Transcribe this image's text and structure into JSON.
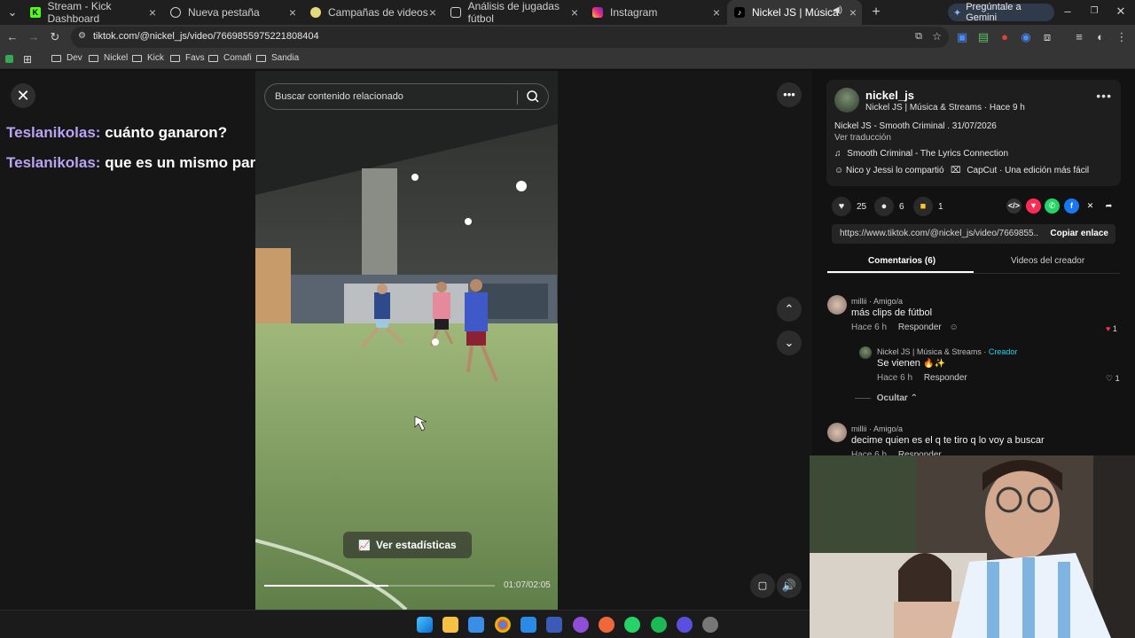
{
  "browser": {
    "tabs": [
      {
        "title": "Stream - Kick Dashboard",
        "icon": "kick-icon",
        "color": "#53fc18",
        "active": false
      },
      {
        "title": "Nueva pestaña",
        "icon": "globe-icon",
        "color": "#cfcfcf",
        "active": false
      },
      {
        "title": "Campañas de videos",
        "icon": "cloud-icon",
        "color": "#e7d97a",
        "active": false
      },
      {
        "title": "Análisis de jugadas fútbol",
        "icon": "chat-icon",
        "color": "#cfcfcf",
        "active": false
      },
      {
        "title": "Instagram",
        "icon": "instagram-icon",
        "color": "#e1306c",
        "active": false
      },
      {
        "title": "Nickel JS | Música & Stream",
        "icon": "tiktok-icon",
        "color": "#ffffff",
        "active": true
      }
    ],
    "gemini_label": "Pregúntale a Gemini",
    "url": "tiktok.com/@nickel_js/video/7669855975221808404",
    "bookmarks": [
      "Dev",
      "Nickel",
      "Kick",
      "Favs",
      "Comafi",
      "Sandia"
    ]
  },
  "chat": {
    "lines": [
      {
        "user": "Teslanikolas:",
        "message": "cuánto ganaron?"
      },
      {
        "user": "Teslanikolas:",
        "message": "que es un mismo partido"
      }
    ]
  },
  "video": {
    "search_placeholder": "Buscar contenido relacionado",
    "stats_label": "Ver estadísticas",
    "time": "01:07/02:05",
    "progress": 0.54
  },
  "post": {
    "username": "nickel_js",
    "subline": "Nickel JS | Música & Streams · Hace 9 h",
    "description": "Nickel JS - Smooth Criminal . 31/07/2026",
    "translate": "Ver traducción",
    "music": "Smooth Criminal - The Lyrics Connection",
    "shared": "Nico y Jessi lo compartió",
    "capcut": "CapCut · Una edición más fácil",
    "likes": "25",
    "comments_count": "6",
    "saves": "1",
    "link": "https://www.tiktok.com/@nickel_js/video/7669855...",
    "copy_link": "Copiar enlace",
    "tab_comments": "Comentarios (6)",
    "tab_videos": "Videos del creador"
  },
  "comments": [
    {
      "author": "millii · Amigo/a",
      "text": "más clips de fútbol",
      "time": "Hace 6 h",
      "reply": "Responder",
      "likes": "1"
    },
    {
      "author": "Nickel JS | Música & Streams · ",
      "creator": "Creador",
      "text": "Se vienen",
      "time": "Hace 6 h",
      "reply": "Responder",
      "likes": "1"
    },
    {
      "author": "millii · Amigo/a",
      "text": "decime quien es el q te tiro q lo voy a buscar",
      "time": "Hace 6 h",
      "reply": "Responder"
    }
  ],
  "hide_label": "Ocultar"
}
